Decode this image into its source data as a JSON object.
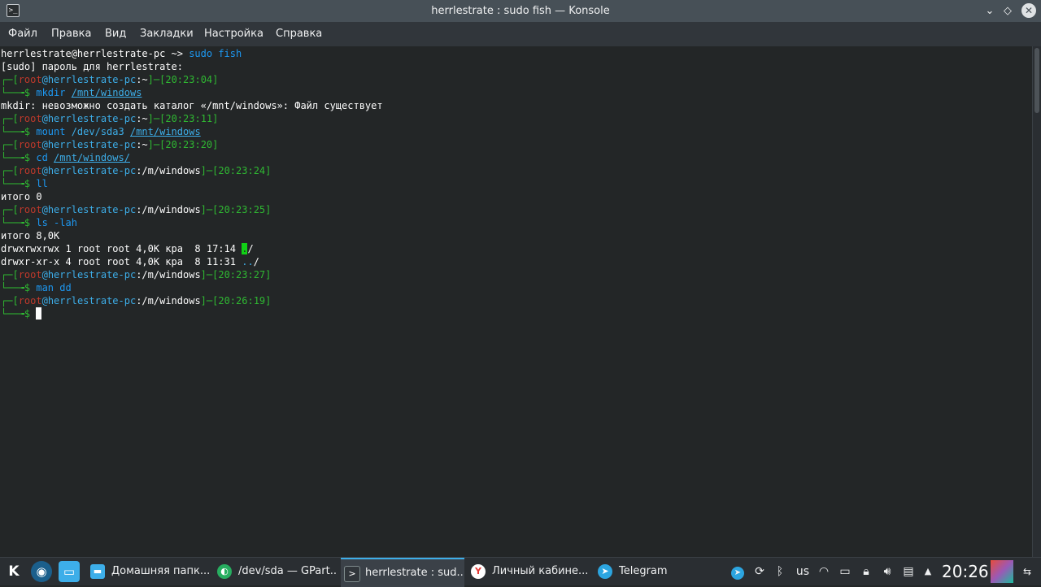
{
  "window": {
    "title": "herrlestrate : sudo fish — Konsole",
    "icon": "terminal-icon",
    "controls": {
      "minimize": "⌄",
      "keep_above": "◇",
      "close": "✕"
    }
  },
  "menu": [
    "Файл",
    "Правка",
    "Вид",
    "Закладки",
    "Настройка",
    "Справка"
  ],
  "terminal": {
    "user_host": "herrlestrate@herrlestrate-pc",
    "home_prompt": " ~> ",
    "first_cmd": "sudo fish",
    "sudo_prompt": "[sudo] пароль для herrlestrate:",
    "root": "root",
    "host": "@herrlestrate-pc",
    "cmds": {
      "c1": {
        "cwd": "~",
        "time": "20:23:04",
        "cmd": "mkdir",
        "arg": "/mnt/windows"
      },
      "c2": {
        "cwd": "~",
        "time": "20:23:11",
        "cmd": "mount",
        "arg0": " /dev/sda3 ",
        "arg": "/mnt/windows"
      },
      "c3": {
        "cwd": "~",
        "time": "20:23:20",
        "cmd": "cd",
        "arg": "/mnt/windows/"
      },
      "c4": {
        "cwd": "/m/windows",
        "time": "20:23:24",
        "cmd": "ll"
      },
      "c5": {
        "cwd": "/m/windows",
        "time": "20:23:25",
        "cmd": "ls -lah"
      },
      "c6": {
        "cwd": "/m/windows",
        "time": "20:23:27",
        "cmd": "man dd"
      },
      "c7": {
        "cwd": "/m/windows",
        "time": "20:26:19"
      }
    },
    "mkdir_error": "mkdir: невозможно создать каталог «/mnt/windows»: Файл существует",
    "total0": "итого 0",
    "total8": "итого 8,0K",
    "ls1_prefix": "drwxrwxrwx 1 root root 4,0K кра  8 17:14 ",
    "ls1_dot": ".",
    "ls1_slash": "/",
    "ls2_prefix": "drwxr-xr-x 4 root root 4,0K кра  8 11:31 ",
    "ls2_dots": "..",
    "ls2_slash": "/"
  },
  "taskbar": {
    "launchers": [
      "kde-logo-icon",
      "steam-icon",
      "file-manager-icon"
    ],
    "tasks": [
      {
        "label": "Домашняя папк...",
        "icon": "folder-icon"
      },
      {
        "label": "/dev/sda — GPart...",
        "icon": "gparted-icon"
      },
      {
        "label": "herrlestrate : sud...",
        "icon": "terminal-icon"
      },
      {
        "label": "Личный кабине...",
        "icon": "yandex-browser-icon"
      },
      {
        "label": "Telegram",
        "icon": "telegram-icon"
      }
    ],
    "keyboard_layout": "us",
    "clock": "20:26"
  },
  "colors": {
    "titlebar": "#475057",
    "menubar": "#31363b",
    "terminal_bg": "#232627",
    "prompt_green": "#2fb832",
    "root_red": "#c0392b",
    "host_cyan": "#3daee9",
    "accent": "#3daee9"
  }
}
